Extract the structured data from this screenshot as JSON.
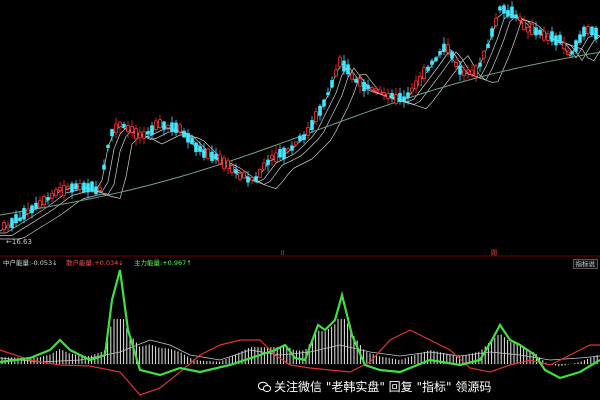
{
  "chart": {
    "low_label": "←16.63",
    "markers": {
      "left": "ll",
      "right": "閥"
    },
    "indicator_button": "指标说"
  },
  "indicators": [
    {
      "name": "中户能量",
      "value": "-0.053",
      "arrow": "↓",
      "color": "#d8d8d8"
    },
    {
      "name": "散户能量",
      "value": "+0.034",
      "arrow": "↓",
      "color": "#ff5050"
    },
    {
      "name": "主力能量",
      "value": "+0.967",
      "arrow": "↑",
      "color": "#50ff50"
    }
  ],
  "watermark": {
    "text": "关注微信 \"老韩实盘\" 回复 \"指标\" 领源码"
  },
  "colors": {
    "up": "#ff3030",
    "down": "#40e8ff",
    "energy_main": "#40e040",
    "energy_retail": "#e03030",
    "energy_mid": "#c8c8c8",
    "ma": "#d0d0d0",
    "ma_long": "#6fa08a"
  },
  "chart_data": {
    "type": "candlestick",
    "title": "",
    "series": [
      {
        "name": "中户能量"
      },
      {
        "name": "散户能量"
      },
      {
        "name": "主力能量"
      }
    ]
  }
}
